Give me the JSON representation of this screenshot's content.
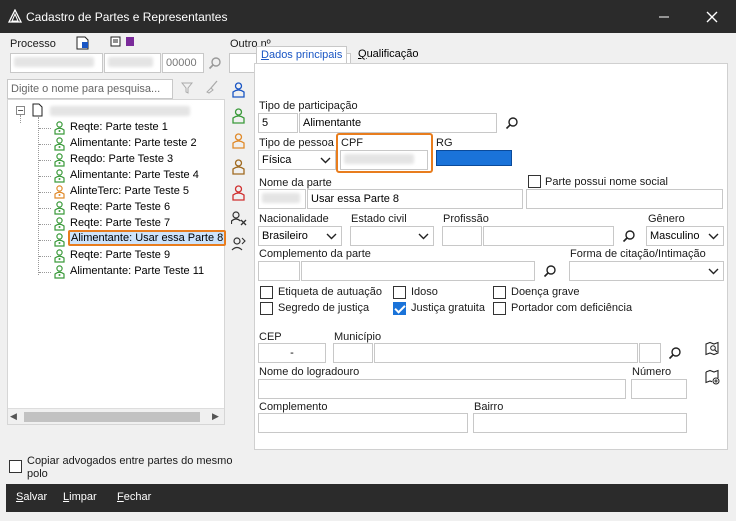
{
  "window": {
    "title": "Cadastro de Partes e Representantes"
  },
  "processo": {
    "label": "Processo",
    "suffix_value": "00000",
    "outro_label": "Outro nº"
  },
  "search": {
    "placeholder": "Digite o nome para pesquisa..."
  },
  "tree": {
    "items": [
      {
        "text": "Reqte: Parte teste 1",
        "color": "#3a9a3a"
      },
      {
        "text": "Alimentante: Parte teste 2",
        "color": "#3a9a3a"
      },
      {
        "text": "Reqdo: Parte Teste 3",
        "color": "#3a9a3a"
      },
      {
        "text": "Alimentante: Parte Teste 4",
        "color": "#3a9a3a"
      },
      {
        "text": "AlinteTerc: Parte Teste 5",
        "color": "#e08a2a"
      },
      {
        "text": "Reqte: Parte Teste 6",
        "color": "#3a9a3a"
      },
      {
        "text": "Reqte: Parte Teste 7",
        "color": "#3a9a3a"
      },
      {
        "text": "Alimentante: Usar essa Parte 8",
        "color": "#3a9a3a",
        "selected": true
      },
      {
        "text": "Reqte: Parte Teste 9",
        "color": "#3a9a3a"
      },
      {
        "text": "Alimentante: Parte Teste 11",
        "color": "#3a9a3a"
      }
    ]
  },
  "copy_lawyers": {
    "label": "Copiar advogados entre partes do mesmo polo"
  },
  "tabs": {
    "main": "Dados principais",
    "main_key": "D",
    "qual": "Qualificação",
    "qual_key": "Q"
  },
  "form": {
    "tipo_participacao_label": "Tipo de participação",
    "tipo_participacao_code": "5",
    "tipo_participacao_value": "Alimentante",
    "tipo_pessoa_label": "Tipo de pessoa",
    "tipo_pessoa_value": "Física",
    "cpf_label": "CPF",
    "rg_label": "RG",
    "nome_label": "Nome da parte",
    "nome_value": "Usar essa Parte 8",
    "nome_social_label": "Parte possui nome social",
    "nacionalidade_label": "Nacionalidade",
    "nacionalidade_value": "Brasileiro",
    "estado_civil_label": "Estado civil",
    "profissao_label": "Profissão",
    "genero_label": "Gênero",
    "genero_value": "Masculino",
    "complemento_parte_label": "Complemento da parte",
    "forma_citacao_label": "Forma de citação/Intimação",
    "checks": [
      {
        "label": "Etiqueta de autuação",
        "checked": false
      },
      {
        "label": "Idoso",
        "checked": false
      },
      {
        "label": "Doença grave",
        "checked": false
      },
      {
        "label": "Segredo de justiça",
        "checked": false
      },
      {
        "label": "Justiça gratuita",
        "checked": true
      },
      {
        "label": "Portador com deficiência",
        "checked": false
      }
    ],
    "cep_label": "CEP",
    "cep_value": "-",
    "municipio_label": "Município",
    "logradouro_label": "Nome do logradouro",
    "numero_label": "Número",
    "complemento_label": "Complemento",
    "bairro_label": "Bairro"
  },
  "footer": {
    "salvar": "Salvar",
    "salvar_key": "S",
    "limpar": "Limpar",
    "limpar_key": "L",
    "fechar": "Fechar",
    "fechar_key": "F"
  },
  "colors": {
    "titlebar": "#2b2b2b",
    "highlight": "#e87d1e",
    "accent": "#1a73d9"
  }
}
